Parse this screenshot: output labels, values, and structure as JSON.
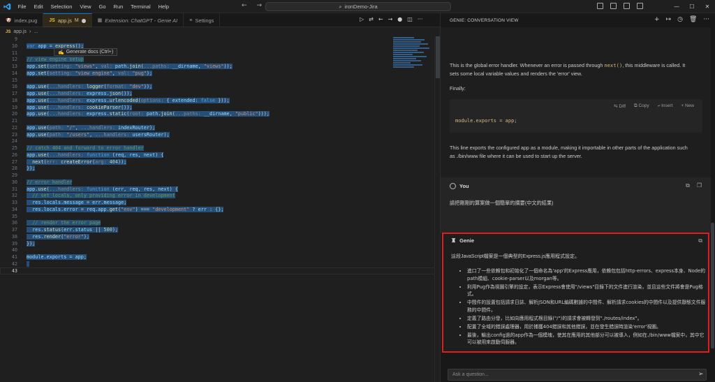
{
  "titlebar": {
    "menu": [
      "File",
      "Edit",
      "Selection",
      "View",
      "Go",
      "Run",
      "Terminal",
      "Help"
    ],
    "search": "ironDemo-Jira"
  },
  "tabs": [
    {
      "label": "index.pug",
      "icon": "pug-icon"
    },
    {
      "label": "app.js",
      "icon": "js-icon",
      "modified": "M"
    },
    {
      "label": "Extension: ChatGPT - Genie AI",
      "icon": "extension-icon"
    },
    {
      "label": "Settings",
      "icon": "settings-icon"
    }
  ],
  "breadcrumb": {
    "file": "app.js",
    "rest": "..."
  },
  "editor": {
    "tooltip": "Generate docs (Ctrl+)",
    "line_numbers": [
      "9",
      "10",
      "11",
      "12",
      "13",
      "14",
      "15",
      "16",
      "17",
      "18",
      "19",
      "20",
      "21",
      "22",
      "23",
      "24",
      "25",
      "26",
      "27",
      "28",
      "29",
      "30",
      "31",
      "32",
      "33",
      "34",
      "35",
      "36",
      "37",
      "38",
      "39",
      "40",
      "41",
      "42",
      "43"
    ],
    "current_line": "43"
  },
  "panel": {
    "title": "GENIE: CONVERSATION VIEW",
    "resp1": {
      "p1a": "This is the global error handler. Whenever an error is passed through ",
      "p1code": "next()",
      "p1b": ", this middleware is called. It",
      "p1c": "sets some local variable values and renders the 'error' view.",
      "finally": "Finally:",
      "code_actions": [
        "Diff",
        "Copy",
        "Insert",
        "New"
      ],
      "code": "module.exports = app;",
      "p2a": "This line exports the configured app as a module, making it importable in other parts of the application such",
      "p2b": "as ./bin/www file where it can be used to start up the server."
    },
    "you": {
      "name": "You",
      "message": "請把剛剛的算案做一個簡單的摘要(中文的結果)"
    },
    "genie": {
      "name": "Genie",
      "intro": "這段JavaScript檔案是一個典型的Express.js應用程式設定。",
      "bullets": [
        "進口了一些依賴包和初始化了一個命名為'app'的Express應用，依賴包包括http-errors、express本身、Node的path模組、cookie-parser以及morgan等。",
        "利用Pug作為視圖引擎的設定，表示Express會使用\"/views\"目錄下的文件進行渲染，並且這些文件將會是Pug格式。",
        "中間件的設置包括請求日誌、解析JSON和URL編碼數據的中間件、解析請求cookies的中間件以及提供靜態文件服務的中間件。",
        "定義了路由分發，比如向應用程式根目錄(\"/\")的請求會被轉發到\"./routes/index\"。",
        "配置了全域的錯誤處理器，用於捕獲404錯誤和其他錯誤，並在發生錯誤時渲染'error'視圖。",
        "最後，輸出config過的app作為一個模塊，使其在應用的其他部分可以被導入，例如在./bin/www檔案中，其中它可以被用來啟動伺服器。"
      ]
    },
    "ask_placeholder": "Ask a question..."
  },
  "colors": {
    "accent": "#0078d4",
    "highlight_border": "#e01e1e",
    "selection": "#264f78"
  }
}
